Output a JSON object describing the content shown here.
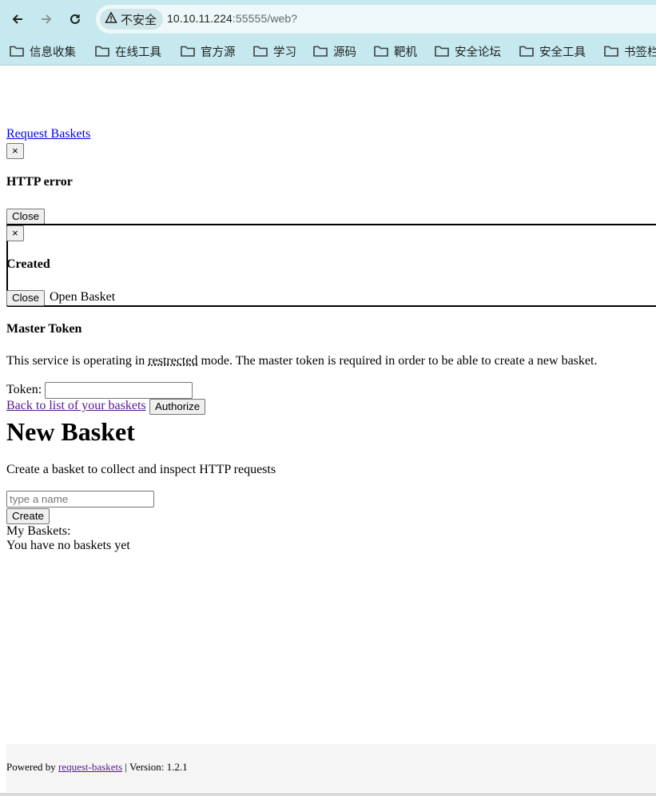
{
  "browser": {
    "security_label": "不安全",
    "url_host": "10.10.11.224",
    "url_rest": ":55555/web?",
    "bookmarks": [
      "信息收集",
      "在线工具",
      "官方源",
      "学习",
      "源码",
      "靶机",
      "安全论坛",
      "安全工具",
      "书签栏"
    ],
    "icons": {
      "back": "back-arrow-icon",
      "forward": "forward-arrow-icon",
      "reload": "reload-icon",
      "warning": "warning-triangle-icon",
      "folder": "folder-icon"
    },
    "colors": {
      "toolbar": "#c5e9ee",
      "omnibox": "#eef8f9"
    }
  },
  "page": {
    "brand_link": "Request Baskets",
    "error_dialog": {
      "close_x": "×",
      "title": "HTTP error",
      "close_button": "Close"
    },
    "created_dialog": {
      "close_x": "×",
      "title": "Created",
      "close_button": "Close",
      "open_basket": "Open Basket"
    },
    "master_token": {
      "title": "Master Token",
      "text_before": "This service is operating in ",
      "abbr": "restrected",
      "text_after": " mode. The master token is required in order to be able to create a new basket.",
      "token_label": "Token:",
      "token_value": "",
      "back_link": "Back to list of your baskets",
      "authorize_button": "Authorize"
    },
    "new_basket": {
      "heading": "New Basket",
      "subtitle": "Create a basket to collect and inspect HTTP requests",
      "name_placeholder": "type a name",
      "name_value": "",
      "create_button": "Create"
    },
    "my_baskets": {
      "label": "My Baskets:",
      "empty_text": "You have no baskets yet"
    },
    "footer": {
      "powered_by": "Powered by ",
      "link": "request-baskets",
      "version": " | Version: 1.2.1"
    }
  }
}
